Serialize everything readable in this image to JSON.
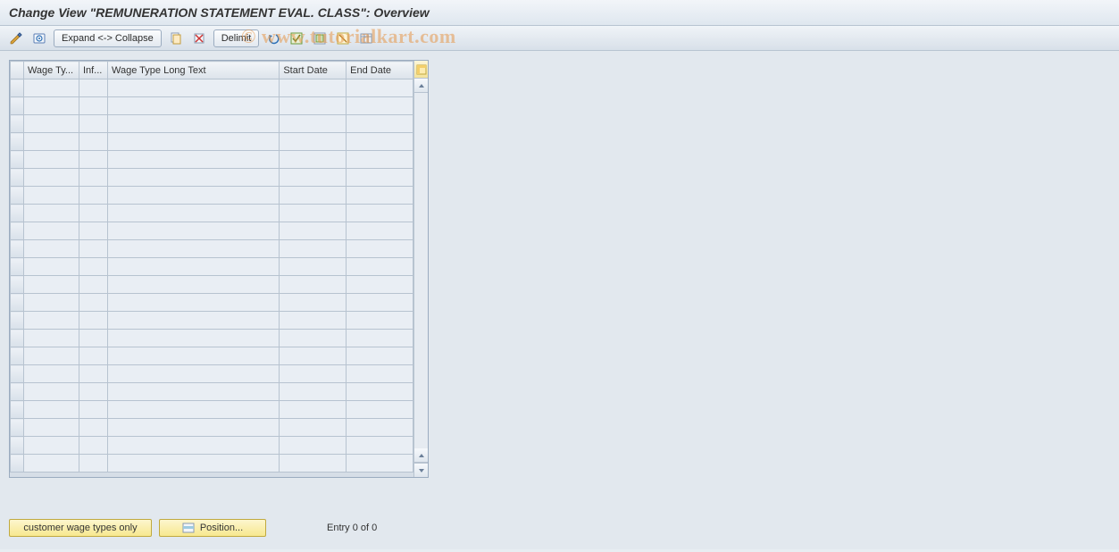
{
  "title": "Change View \"REMUNERATION STATEMENT EVAL. CLASS\": Overview",
  "toolbar": {
    "expand_collapse_label": "Expand <-> Collapse",
    "delimit_label": "Delimit"
  },
  "watermark": "© www.tutorialkart.com",
  "table": {
    "columns": {
      "wage_type": "Wage Ty...",
      "inf": "Inf...",
      "long_text": "Wage Type Long Text",
      "start_date": "Start Date",
      "end_date": "End Date"
    },
    "row_count": 22
  },
  "bottom": {
    "customer_btn_label": "customer wage types only",
    "position_btn_label": "Position...",
    "entry_text": "Entry 0 of 0"
  }
}
